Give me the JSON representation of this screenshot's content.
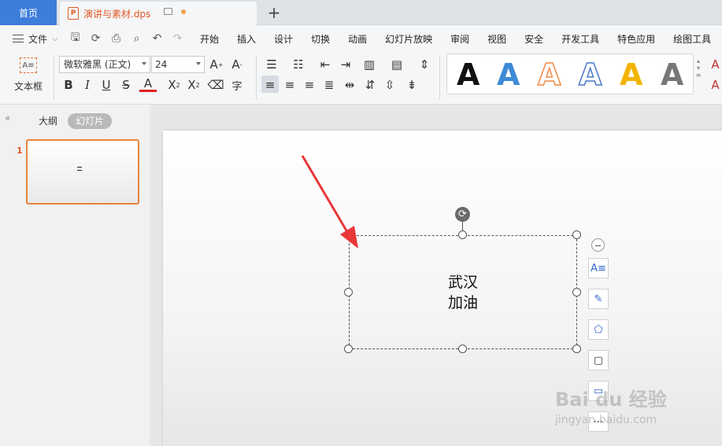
{
  "tabs": {
    "home": "首页",
    "document": "演讲与素材.dps"
  },
  "menu": {
    "file": "文件",
    "items": [
      "开始",
      "插入",
      "设计",
      "切换",
      "动画",
      "幻灯片放映",
      "审阅",
      "视图",
      "安全",
      "开发工具",
      "特色应用",
      "绘图工具"
    ]
  },
  "ribbon": {
    "textbox_label": "文本框",
    "font_name": "微软雅黑 (正文)",
    "font_size": "24",
    "art_letters": [
      "A",
      "A",
      "A",
      "A",
      "A",
      "A"
    ],
    "art_colors": [
      "#111111",
      "#3d8ad6",
      "#f08a40",
      "#4a78c8",
      "#f2b400",
      "#777777"
    ]
  },
  "left_panel": {
    "outline_tab": "大纲",
    "slides_tab": "幻灯片",
    "slide_number": "1"
  },
  "slide": {
    "text_line1": "武汉",
    "text_line2": "加油"
  },
  "watermark": {
    "brand": "Bai du 经验",
    "url": "jingyan.baidu.com"
  }
}
